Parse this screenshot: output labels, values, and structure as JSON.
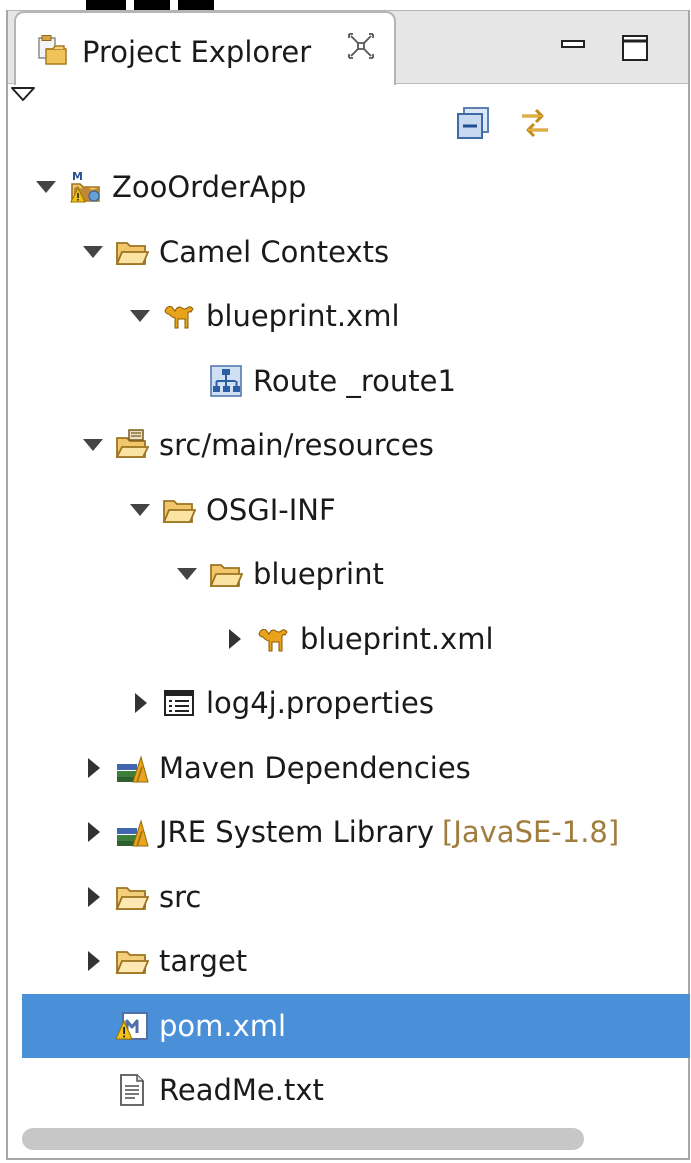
{
  "tab": {
    "title": "Project Explorer"
  },
  "tree": [
    {
      "label": "ZooOrderApp",
      "expanded": true,
      "icon": "maven-project-warning-icon",
      "depth": 0
    },
    {
      "label": "Camel Contexts",
      "expanded": true,
      "icon": "folder-open-icon",
      "depth": 1
    },
    {
      "label": "blueprint.xml",
      "expanded": true,
      "icon": "camel-icon",
      "depth": 2
    },
    {
      "label": "Route _route1",
      "expanded": null,
      "icon": "route-icon",
      "depth": 3
    },
    {
      "label": "src/main/resources",
      "expanded": true,
      "icon": "source-folder-icon",
      "depth": 1
    },
    {
      "label": "OSGI-INF",
      "expanded": true,
      "icon": "folder-open-icon",
      "depth": 2
    },
    {
      "label": "blueprint",
      "expanded": true,
      "icon": "folder-open-icon",
      "depth": 3
    },
    {
      "label": "blueprint.xml",
      "expanded": false,
      "icon": "camel-icon",
      "depth": 4
    },
    {
      "label": "log4j.properties",
      "expanded": false,
      "icon": "properties-file-icon",
      "depth": 2
    },
    {
      "label": "Maven Dependencies",
      "expanded": false,
      "icon": "library-icon",
      "depth": 1
    },
    {
      "label": "JRE System Library",
      "decoration": "[JavaSE-1.8]",
      "expanded": false,
      "icon": "library-icon",
      "depth": 1
    },
    {
      "label": "src",
      "expanded": false,
      "icon": "folder-icon",
      "depth": 1
    },
    {
      "label": "target",
      "expanded": false,
      "icon": "folder-icon",
      "depth": 1
    },
    {
      "label": "pom.xml",
      "expanded": null,
      "icon": "maven-pom-warning-icon",
      "depth": 1,
      "selected": true
    },
    {
      "label": "ReadMe.txt",
      "expanded": null,
      "icon": "text-file-icon",
      "depth": 1
    }
  ],
  "colors": {
    "selection": "#4a90d9",
    "decoration": "#a07d3c",
    "folder": "#e6b34d"
  }
}
